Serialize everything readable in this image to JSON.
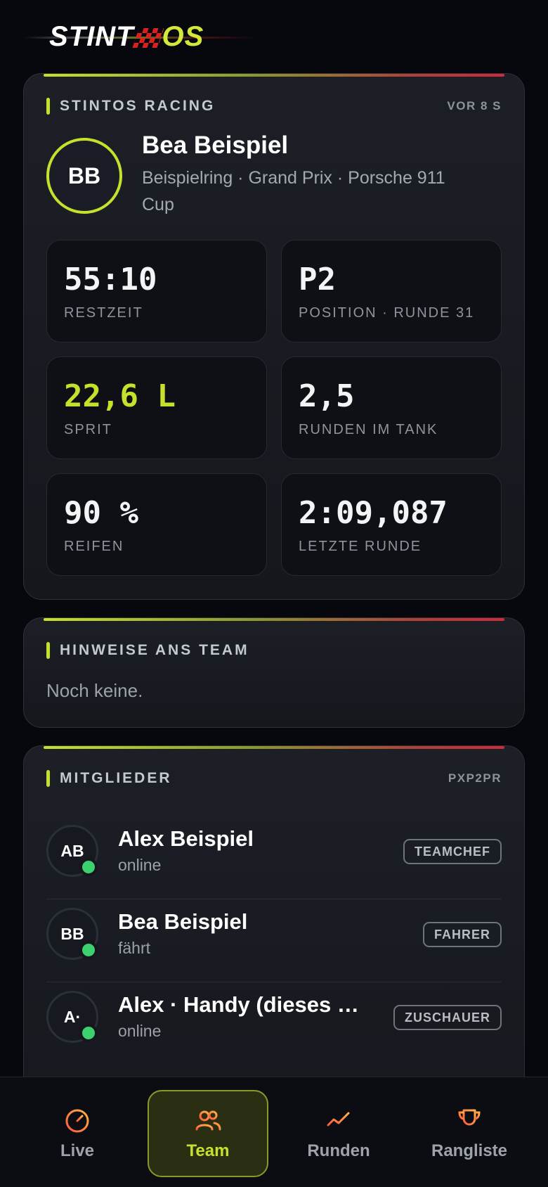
{
  "logo": {
    "text_left": "STINT",
    "text_right": "OS"
  },
  "driver_card": {
    "team_name": "STINTOS RACING",
    "updated": "VOR 8 S",
    "avatar_initials": "BB",
    "driver_name": "Bea Beispiel",
    "session_info": "Beispielring · Grand Prix · Porsche 911 Cup",
    "stats": [
      {
        "value": "55:10",
        "label": "RESTZEIT",
        "accent": false
      },
      {
        "value": "P2",
        "label": "POSITION · RUNDE 31",
        "accent": false
      },
      {
        "value": "22,6 L",
        "label": "SPRIT",
        "accent": true
      },
      {
        "value": "2,5",
        "label": "RUNDEN IM TANK",
        "accent": false
      },
      {
        "value": "90 %",
        "label": "REIFEN",
        "accent": false
      },
      {
        "value": "2:09,087",
        "label": "LETZTE RUNDE",
        "accent": false
      }
    ]
  },
  "hints_card": {
    "title": "HINWEISE ANS TEAM",
    "empty_text": "Noch keine."
  },
  "members_card": {
    "title": "MITGLIEDER",
    "code": "PXP2PR",
    "members": [
      {
        "initials": "AB",
        "name": "Alex Beispiel",
        "status": "online",
        "role": "TEAMCHEF"
      },
      {
        "initials": "BB",
        "name": "Bea Beispiel",
        "status": "fährt",
        "role": "FAHRER"
      },
      {
        "initials": "A·",
        "name": "Alex · Handy (dieses …",
        "status": "online",
        "role": "ZUSCHAUER"
      }
    ]
  },
  "nav": {
    "items": [
      {
        "label": "Live",
        "icon": "gauge-icon"
      },
      {
        "label": "Team",
        "icon": "users-icon",
        "active": true
      },
      {
        "label": "Runden",
        "icon": "chart-line-icon"
      },
      {
        "label": "Rangliste",
        "icon": "trophy-icon"
      }
    ]
  },
  "colors": {
    "accent": "#c7e02c",
    "online": "#3bd16f",
    "nav_icon_gradient": [
      "#ff5a3c",
      "#ffb347"
    ]
  }
}
